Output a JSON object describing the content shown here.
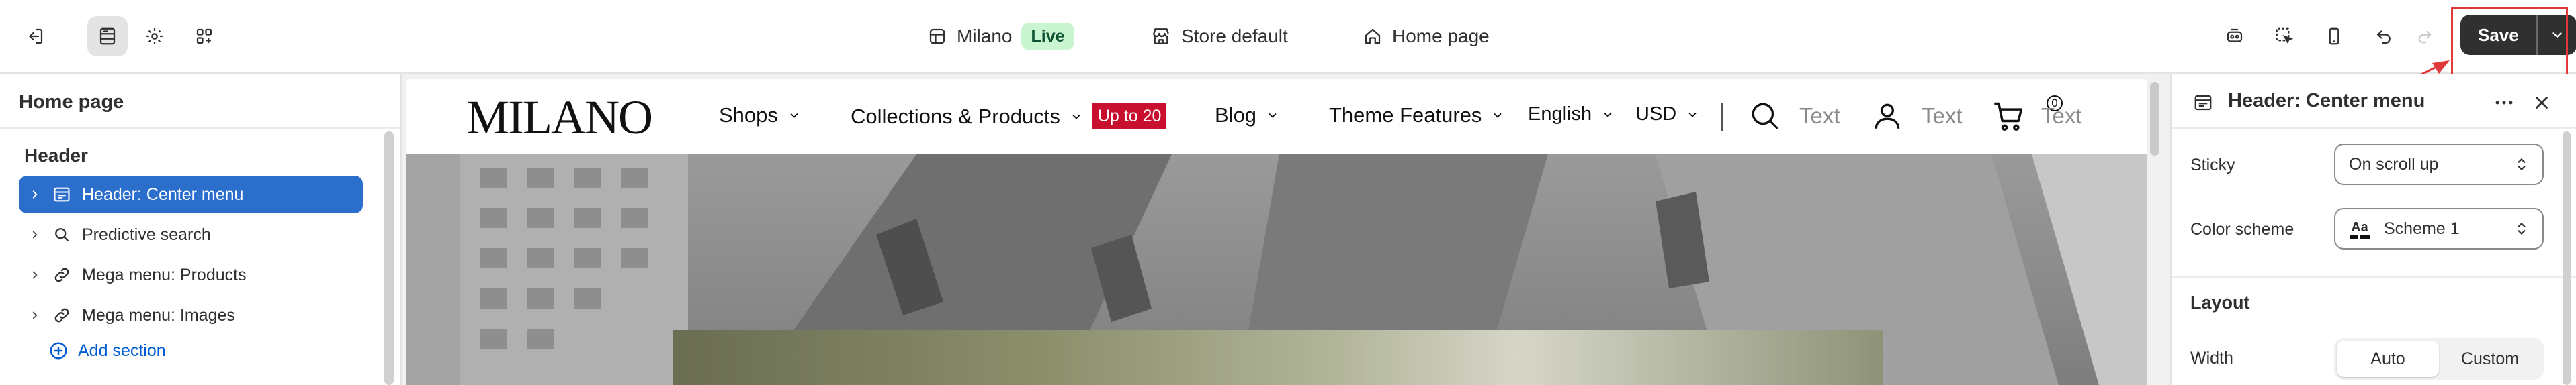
{
  "topbar": {
    "store_name": "Milano",
    "live_badge": "Live",
    "store_default": "Store default",
    "page": "Home page",
    "save_label": "Save"
  },
  "left_panel": {
    "title": "Home page",
    "section_label": "Header",
    "items": [
      {
        "label": "Header: Center menu",
        "icon": "header-layout-icon",
        "selected": true
      },
      {
        "label": "Predictive search",
        "icon": "search-icon",
        "selected": false
      },
      {
        "label": "Mega menu: Products",
        "icon": "link-icon",
        "selected": false
      },
      {
        "label": "Mega menu: Images",
        "icon": "link-icon",
        "selected": false
      }
    ],
    "add_section": "Add section"
  },
  "preview": {
    "logo": "MILANO",
    "nav": [
      {
        "label": "Shops"
      },
      {
        "label": "Collections & Products",
        "badge": "Up to 20"
      },
      {
        "label": "Blog"
      },
      {
        "label": "Theme Features"
      }
    ],
    "language": "English",
    "currency": "USD",
    "search_text": "Text",
    "account_text": "Text",
    "cart_text": "Text",
    "cart_count": "0"
  },
  "right_panel": {
    "title": "Header: Center menu",
    "sticky_label": "Sticky",
    "sticky_value": "On scroll up",
    "color_scheme_label": "Color scheme",
    "color_scheme_value": "Scheme 1",
    "color_scheme_swatch_text": "Aa",
    "layout_title": "Layout",
    "width_label": "Width",
    "width_options": [
      "Auto",
      "Custom"
    ],
    "width_selected": "Auto"
  },
  "colors": {
    "accent": "#2c6ecb",
    "live_badge_bg": "#c9f5d1",
    "sale_badge": "#c8102e",
    "save_button": "#303030",
    "annotation": "#e03a3a"
  }
}
